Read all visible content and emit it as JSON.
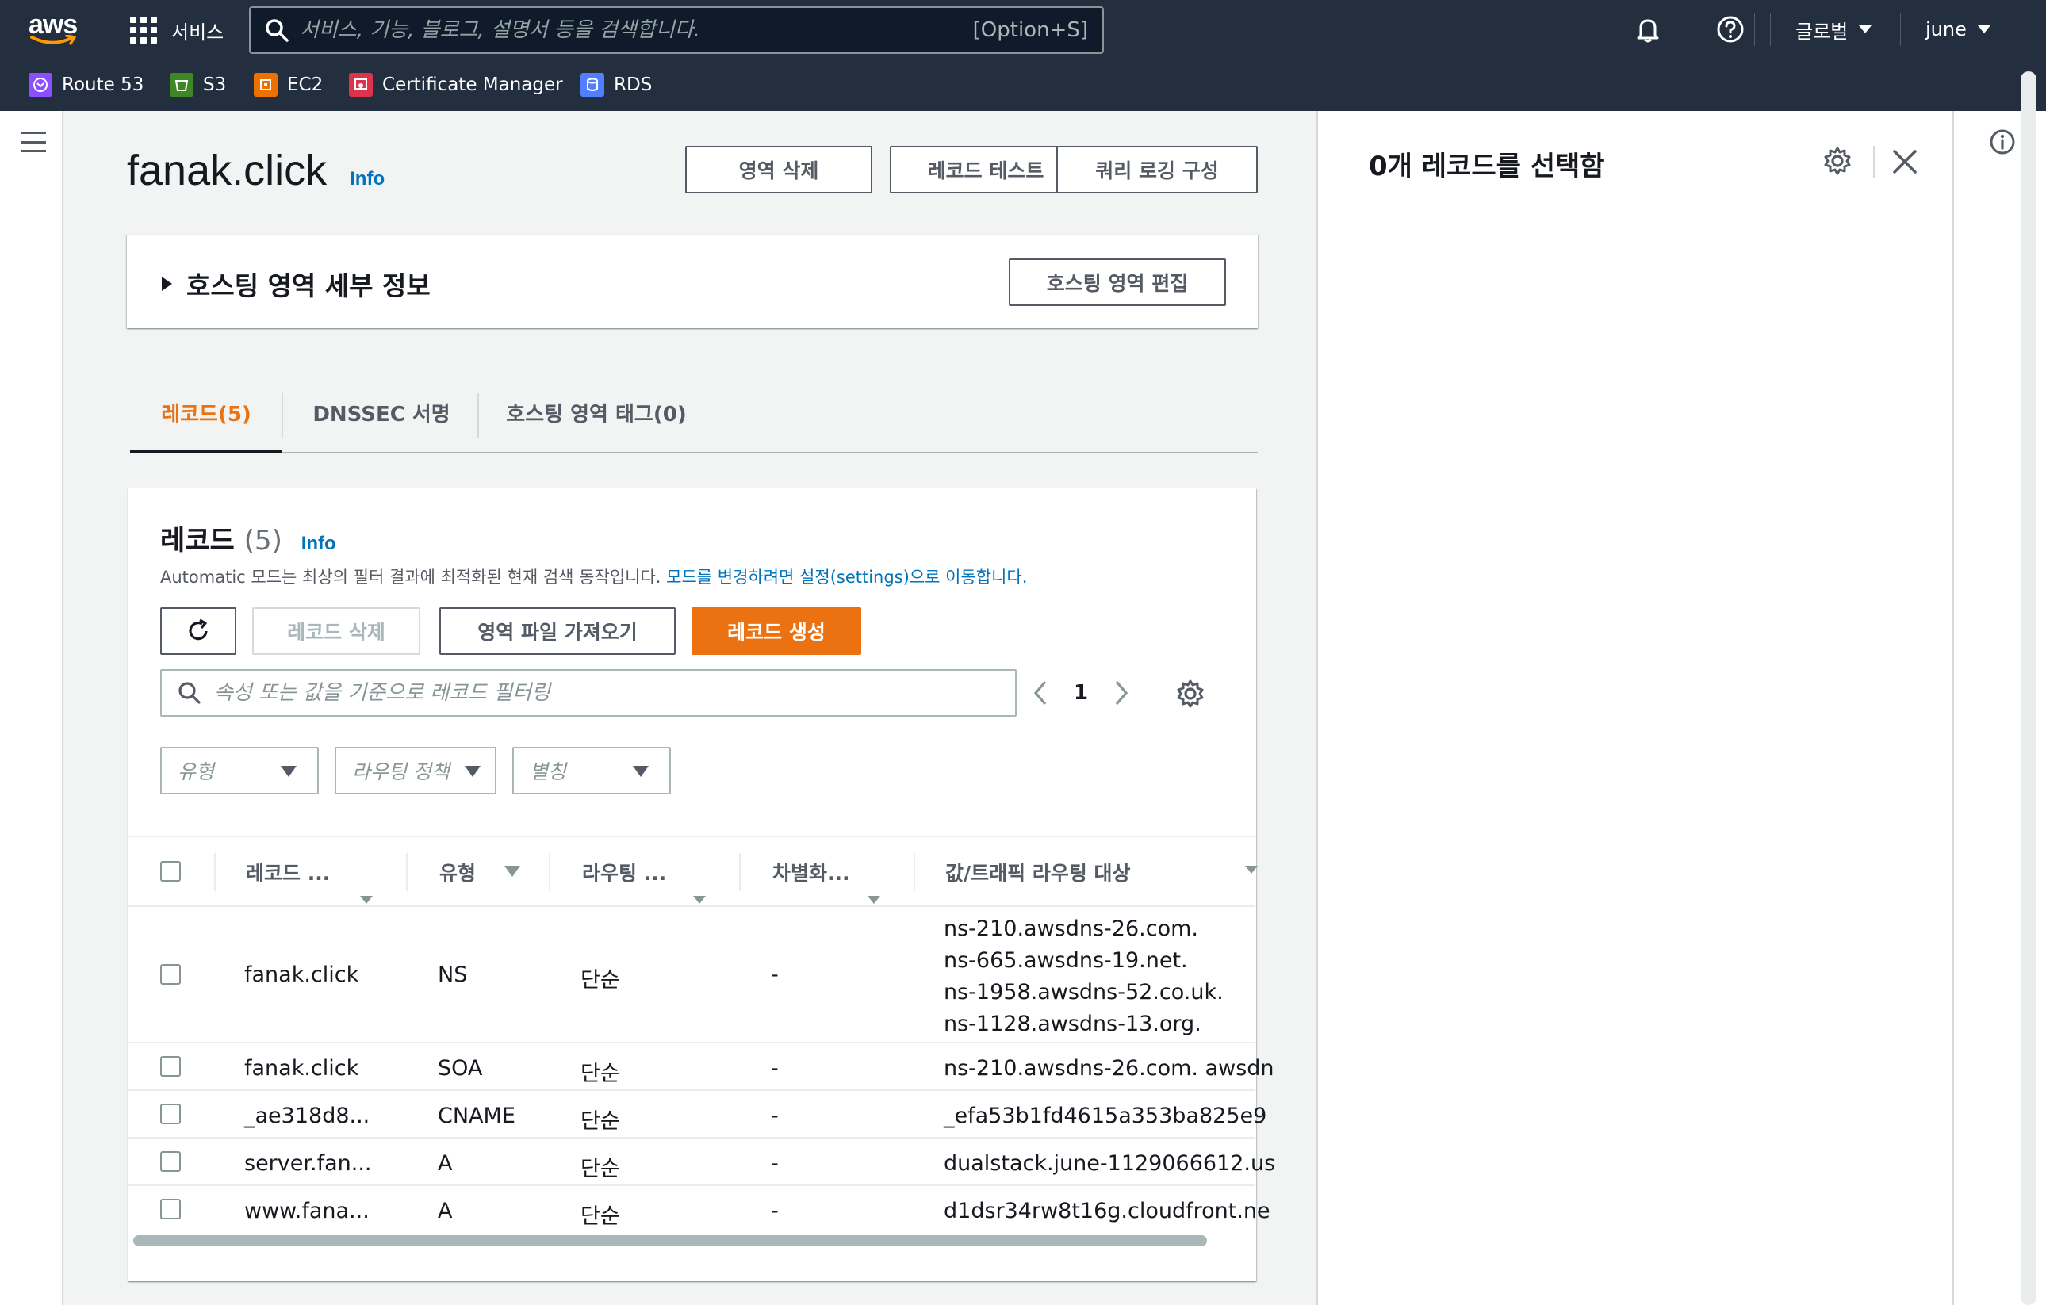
{
  "topnav": {
    "logo": "aws",
    "services_label": "서비스",
    "search_placeholder": "서비스, 기능, 블로그, 설명서 등을 검색합니다.",
    "search_shortcut": "[Option+S]",
    "region": "글로벌",
    "user": "june"
  },
  "favorites": [
    {
      "label": "Route 53",
      "color": "#8c4fff"
    },
    {
      "label": "S3",
      "color": "#3f8624"
    },
    {
      "label": "EC2",
      "color": "#ed7100"
    },
    {
      "label": "Certificate Manager",
      "color": "#dd344c"
    },
    {
      "label": "RDS",
      "color": "#527fff"
    }
  ],
  "page": {
    "title": "fanak.click",
    "info": "Info",
    "actions": {
      "delete_zone": "영역 삭제",
      "test_record": "레코드 테스트",
      "query_logging": "쿼리 로깅 구성"
    }
  },
  "details": {
    "title": "호스팅 영역 세부 정보",
    "edit_button": "호스팅 영역 편집"
  },
  "tabs": [
    {
      "label": "레코드(5)",
      "active": true
    },
    {
      "label": "DNSSEC 서명",
      "active": false
    },
    {
      "label": "호스팅 영역 태그(0)",
      "active": false
    }
  ],
  "records": {
    "title": "레코드",
    "count": "(5)",
    "info": "Info",
    "desc_prefix": "Automatic 모드는 최상의 필터 결과에 최적화된 현재 검색 동작입니다.",
    "desc_link": "모드를 변경하려면 설정(settings)으로 이동합니다.",
    "buttons": {
      "delete": "레코드 삭제",
      "import": "영역 파일 가져오기",
      "create": "레코드 생성"
    },
    "filter_placeholder": "속성 또는 값을 기준으로 레코드 필터링",
    "page_number": "1",
    "dropdowns": {
      "type": "유형",
      "routing": "라우팅 정책",
      "alias": "별칭"
    },
    "columns": {
      "name": "레코드 ...",
      "type": "유형",
      "routing": "라우팅 ...",
      "diff": "차별화...",
      "value": "값/트래픽 라우팅 대상"
    },
    "rows": [
      {
        "name": "fanak.click",
        "type": "NS",
        "routing": "단순",
        "diff": "-",
        "values": [
          "ns-210.awsdns-26.com.",
          "ns-665.awsdns-19.net.",
          "ns-1958.awsdns-52.co.uk.",
          "ns-1128.awsdns-13.org."
        ]
      },
      {
        "name": "fanak.click",
        "type": "SOA",
        "routing": "단순",
        "diff": "-",
        "values": [
          "ns-210.awsdns-26.com. awsdn"
        ]
      },
      {
        "name": "_ae318d8...",
        "type": "CNAME",
        "routing": "단순",
        "diff": "-",
        "values": [
          "_efa53b1fd4615a353ba825e9"
        ]
      },
      {
        "name": "server.fan...",
        "type": "A",
        "routing": "단순",
        "diff": "-",
        "values": [
          "dualstack.june-1129066612.us"
        ]
      },
      {
        "name": "www.fana...",
        "type": "A",
        "routing": "단순",
        "diff": "-",
        "values": [
          "d1dsr34rw8t16g.cloudfront.ne"
        ]
      }
    ]
  },
  "panel": {
    "title": "0개 레코드를 선택함"
  }
}
